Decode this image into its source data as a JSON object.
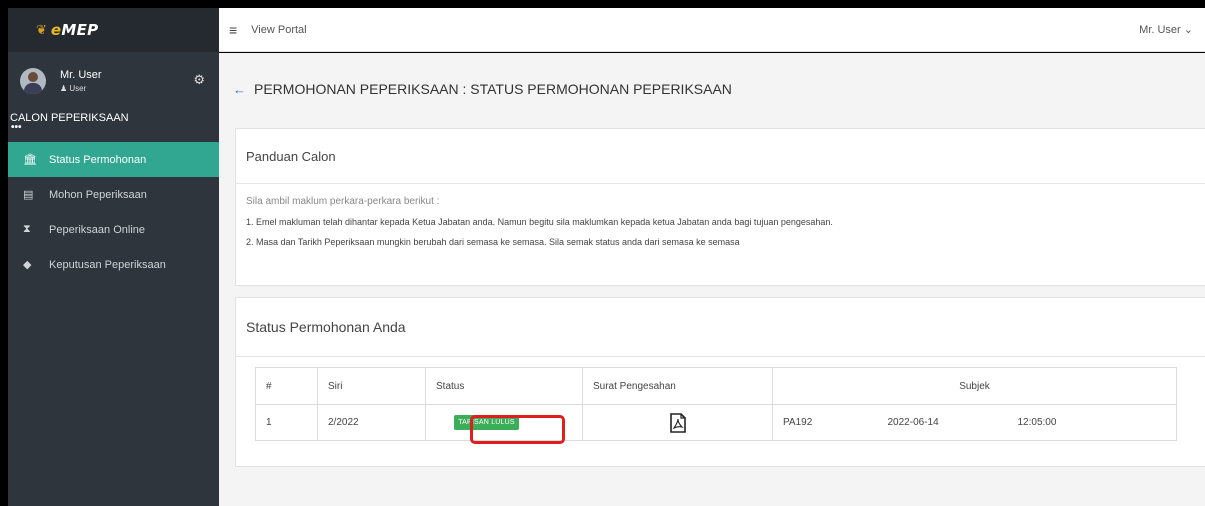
{
  "brand": {
    "prefix": "e",
    "name": "MEP"
  },
  "profile": {
    "name": "Mr. User",
    "role": "User"
  },
  "sidebar": {
    "section": "CALON PEPERIKSAAN",
    "items": [
      {
        "label": "Status Permohonan",
        "icon": "bank-icon",
        "active": true
      },
      {
        "label": "Mohon Peperiksaan",
        "icon": "newspaper-icon",
        "active": false
      },
      {
        "label": "Peperiksaan Online",
        "icon": "hourglass-icon",
        "active": false
      },
      {
        "label": "Keputusan Peperiksaan",
        "icon": "graduation-cap-icon",
        "active": false
      }
    ]
  },
  "topbar": {
    "view_portal": "View Portal",
    "user": "Mr. User"
  },
  "page": {
    "title": "PERMOHONAN PEPERIKSAAN : STATUS PERMOHONAN PEPERIKSAAN"
  },
  "guide": {
    "title": "Panduan Calon",
    "intro": "Sila ambil maklum perkara-perkara berikut :",
    "items": [
      "1. Emel makluman telah dihantar kepada Ketua Jabatan anda. Namun begitu sila maklumkan kepada ketua Jabatan anda bagi tujuan pengesahan.",
      "2. Masa dan Tarikh Peperiksaan mungkin berubah dari semasa ke semasa. Sila semak status anda dari semasa ke semasa"
    ]
  },
  "status_card": {
    "title": "Status Permohonan Anda",
    "columns": [
      "#",
      "Siri",
      "Status",
      "Surat Pengesahan",
      "Subjek"
    ],
    "rows": [
      {
        "num": "1",
        "siri": "2/2022",
        "status": "TAPISAN LULUS",
        "subject_code": "PA192",
        "date": "2022-06-14",
        "time": "12:05:00"
      }
    ]
  },
  "colors": {
    "accent": "#31a792",
    "badge": "#3cae5a",
    "highlight": "#e01e1e",
    "sidebar": "#2e353d"
  }
}
